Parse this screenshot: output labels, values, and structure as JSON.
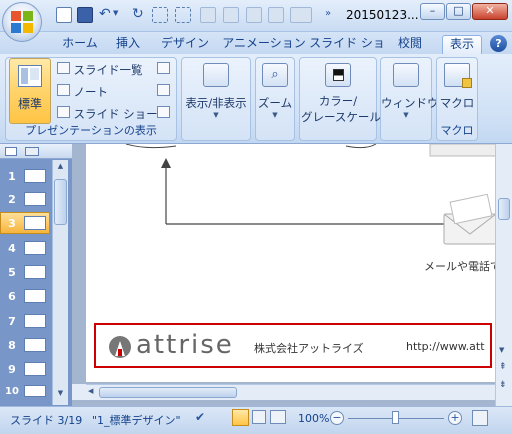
{
  "window": {
    "title": "20150123...",
    "minimize_label": "–",
    "maximize_label": "□",
    "close_label": "✕"
  },
  "tabs": [
    {
      "label": "ホーム"
    },
    {
      "label": "挿入"
    },
    {
      "label": "デザイン"
    },
    {
      "label": "アニメーション"
    },
    {
      "label": "スライド ショー"
    },
    {
      "label": "校閲"
    },
    {
      "label": "表示"
    }
  ],
  "help_label": "?",
  "ribbon": {
    "presentation_views": {
      "normal_label": "標準",
      "slide_sorter_label": "スライド一覧",
      "notes_label": "ノート",
      "slide_show_label": "スライド ショー",
      "group_label": "プレゼンテーションの表示"
    },
    "show_hide_label": "表示/非表示",
    "zoom_label": "ズーム",
    "color_label_1": "カラー/",
    "color_label_2": "グレースケール",
    "window_label": "ウィンドウ",
    "macro_label": "マクロ",
    "macro_group_label": "マクロ"
  },
  "slides": [
    "1",
    "2",
    "3",
    "4",
    "5",
    "6",
    "7",
    "8",
    "9",
    "10"
  ],
  "slide_content": {
    "mail_caption": "メールや電話で",
    "logo_text": "attrise",
    "company_name": "株式会社アットライズ",
    "url": "http://www.att"
  },
  "status": {
    "slide_counter": "スライド 3/19",
    "theme": "\"1_標準デザイン\"",
    "zoom": "100%"
  },
  "colors": {
    "accent_red": "#cc0000",
    "ribbon_blue": "#15428b"
  }
}
